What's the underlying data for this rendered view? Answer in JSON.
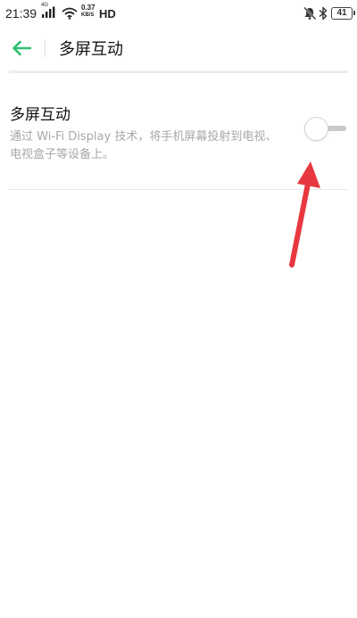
{
  "status_bar": {
    "time": "21:39",
    "signal_label": "4G",
    "net_speed_value": "0.37",
    "net_speed_unit": "KB/S",
    "hd_label": "HD",
    "battery_level": "41",
    "icons": [
      "signal-icon",
      "wifi-icon",
      "mute-icon",
      "bluetooth-icon",
      "battery-icon"
    ]
  },
  "header": {
    "back_icon": "arrow-left-icon",
    "title": "多屏互动",
    "accent_color": "#2fbf71"
  },
  "setting": {
    "title": "多屏互动",
    "description": "通过 Wi-Fi Display 技术，将手机屏幕投射到电视、电视盒子等设备上。",
    "toggle_state": "off"
  },
  "annotation": {
    "arrow_icon": "red-arrow-pointer",
    "color": "#e8383f"
  }
}
